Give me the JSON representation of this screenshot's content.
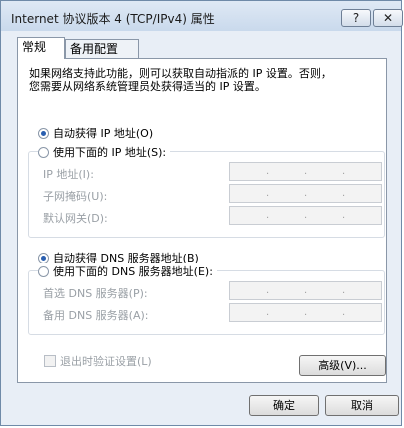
{
  "window": {
    "title": "Internet 协议版本 4 (TCP/IPv4) 属性",
    "help_label": "?",
    "close_label": "✕"
  },
  "tabs": [
    {
      "label": "常规",
      "active": true
    },
    {
      "label": "备用配置",
      "active": false
    }
  ],
  "description": "如果网络支持此功能，则可以获取自动指派的 IP 设置。否则，\n您需要从网络系统管理员处获得适当的 IP 设置。",
  "ip": {
    "auto_label": "自动获得 IP 地址(O)",
    "manual_label": "使用下面的 IP 地址(S):",
    "selected": "auto",
    "fields": [
      {
        "label": "IP 地址(I):",
        "value": ""
      },
      {
        "label": "子网掩码(U):",
        "value": ""
      },
      {
        "label": "默认网关(D):",
        "value": ""
      }
    ]
  },
  "dns": {
    "auto_label": "自动获得 DNS 服务器地址(B)",
    "manual_label": "使用下面的 DNS 服务器地址(E):",
    "selected": "auto",
    "fields": [
      {
        "label": "首选 DNS 服务器(P):",
        "value": ""
      },
      {
        "label": "备用 DNS 服务器(A):",
        "value": ""
      }
    ]
  },
  "validate_label": "退出时验证设置(L)",
  "advanced_label": "高级(V)...",
  "ok_label": "确定",
  "cancel_label": "取消"
}
